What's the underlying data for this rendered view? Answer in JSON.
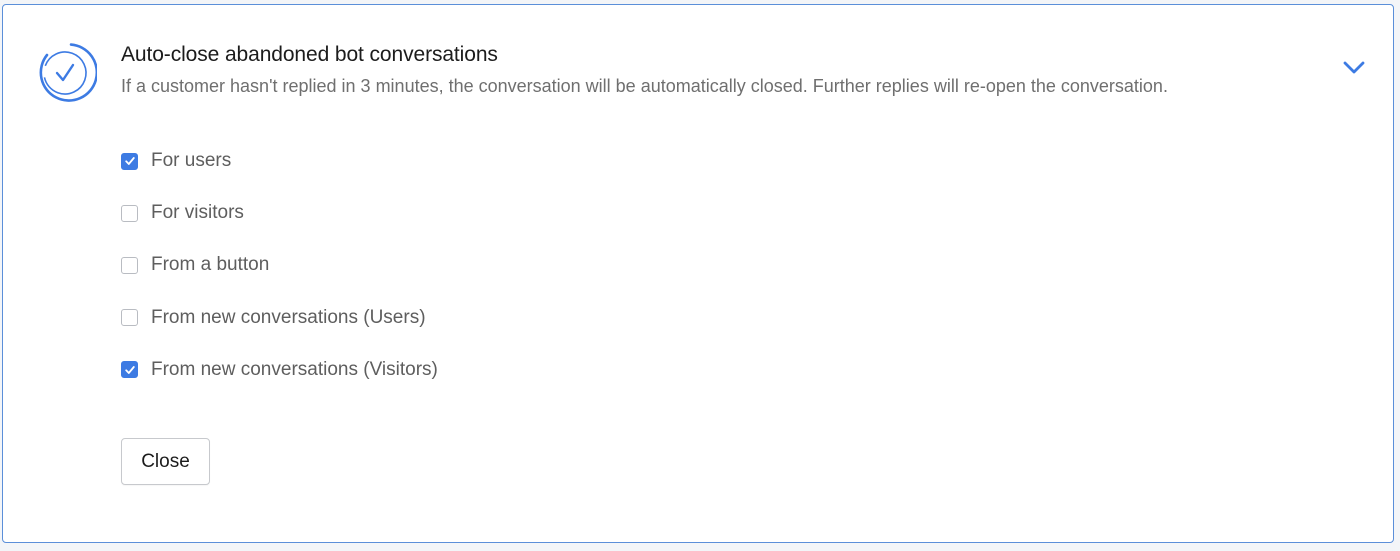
{
  "panel": {
    "title": "Auto-close abandoned bot conversations",
    "description": "If a customer hasn't replied in 3 minutes, the conversation will be automatically closed. Further replies will re-open the conversation.",
    "status_icon": "circle-check-icon",
    "expand_icon": "chevron-down-icon"
  },
  "options": [
    {
      "label": "For users",
      "checked": true
    },
    {
      "label": "For visitors",
      "checked": false
    },
    {
      "label": "From a button",
      "checked": false
    },
    {
      "label": "From new conversations (Users)",
      "checked": false
    },
    {
      "label": "From new conversations (Visitors)",
      "checked": true
    }
  ],
  "actions": {
    "close_label": "Close"
  },
  "colors": {
    "accent": "#3d7be3",
    "border": "#5b8fd9",
    "text_primary": "#1c1c1c",
    "text_secondary": "#6f6f6f"
  }
}
